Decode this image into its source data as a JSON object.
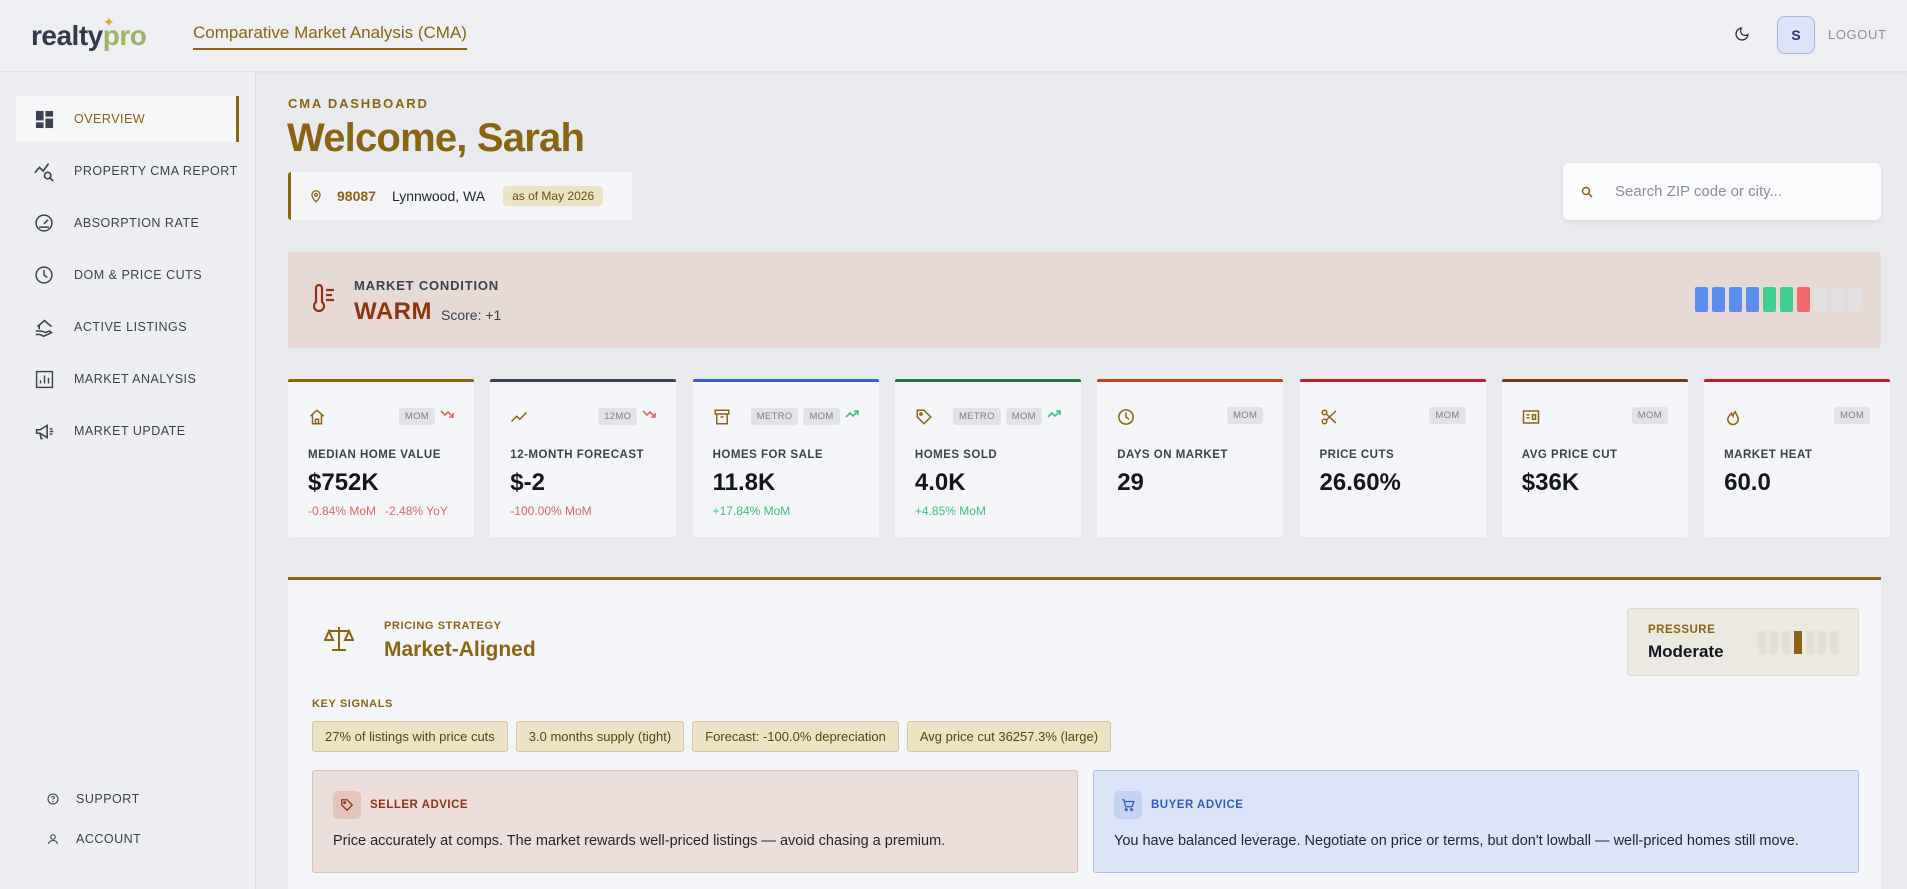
{
  "header": {
    "logo_primary": "realty",
    "logo_secondary": "pro",
    "title": "Comparative Market Analysis (CMA)",
    "theme_icon": "moon-icon",
    "avatar_initial": "S",
    "logout_label": "LOGOUT"
  },
  "sidebar": {
    "items": [
      {
        "label": "OVERVIEW",
        "icon": "dashboard-icon",
        "active": true
      },
      {
        "label": "PROPERTY CMA REPORT",
        "icon": "chart-search-icon"
      },
      {
        "label": "ABSORPTION RATE",
        "icon": "gauge-icon"
      },
      {
        "label": "DOM & PRICE CUTS",
        "icon": "clock-icon"
      },
      {
        "label": "ACTIVE LISTINGS",
        "icon": "house-hand-icon"
      },
      {
        "label": "MARKET ANALYSIS",
        "icon": "bar-chart-icon"
      },
      {
        "label": "MARKET UPDATE",
        "icon": "megaphone-icon"
      }
    ],
    "bottom": [
      {
        "label": "SUPPORT",
        "icon": "help-icon"
      },
      {
        "label": "ACCOUNT",
        "icon": "user-icon"
      }
    ]
  },
  "dashboard": {
    "kicker": "CMA DASHBOARD",
    "welcome": "Welcome, Sarah",
    "zip": "98087",
    "city": "Lynnwood, WA",
    "as_of": "as of May 2026"
  },
  "search": {
    "placeholder": "Search ZIP code or city..."
  },
  "market": {
    "label": "MARKET CONDITION",
    "value": "WARM",
    "score": "Score: +1",
    "meter_colors": [
      "#5b8dee",
      "#5b8dee",
      "#5b8dee",
      "#5b8dee",
      "#3fcf8e",
      "#3fcf8e",
      "#f26b6b",
      "#e4e1e2",
      "#e4e1e2",
      "#e4e1e2"
    ]
  },
  "cards": [
    {
      "label": "MEDIAN HOME VALUE",
      "value": "$752K",
      "tags": [
        "MOM"
      ],
      "trend": "down",
      "changes": [
        {
          "text": "-0.84% MoM",
          "dir": "neg"
        },
        {
          "text": "-2.48% YoY",
          "dir": "neg"
        }
      ],
      "accent": "#8a6410",
      "icon": "home-icon"
    },
    {
      "label": "12-MONTH FORECAST",
      "value": "$-2",
      "tags": [
        "12MO"
      ],
      "trend": "down",
      "changes": [
        {
          "text": "-100.00% MoM",
          "dir": "neg"
        }
      ],
      "accent": "#3b4258",
      "icon": "trend-icon"
    },
    {
      "label": "HOMES FOR SALE",
      "value": "11.8K",
      "tags": [
        "METRO",
        "MOM"
      ],
      "trend": "up",
      "changes": [
        {
          "text": "+17.84% MoM",
          "dir": "pos"
        }
      ],
      "accent": "#2f62d9",
      "icon": "archive-icon"
    },
    {
      "label": "HOMES SOLD",
      "value": "4.0K",
      "tags": [
        "METRO",
        "MOM"
      ],
      "trend": "up",
      "changes": [
        {
          "text": "+4.85% MoM",
          "dir": "pos"
        }
      ],
      "accent": "#1e7a3c",
      "icon": "tag-icon"
    },
    {
      "label": "DAYS ON MARKET",
      "value": "29",
      "tags": [
        "MOM"
      ],
      "trend": "",
      "changes": [],
      "accent": "#c0461a",
      "icon": "clock-icon"
    },
    {
      "label": "PRICE CUTS",
      "value": "26.60%",
      "tags": [
        "MOM"
      ],
      "trend": "",
      "changes": [],
      "accent": "#c41f1f",
      "icon": "scissors-icon"
    },
    {
      "label": "AVG PRICE CUT",
      "value": "$36K",
      "tags": [
        "MOM"
      ],
      "trend": "",
      "changes": [],
      "accent": "#7a3a14",
      "icon": "receipt-icon"
    },
    {
      "label": "MARKET HEAT",
      "value": "60.0",
      "tags": [
        "MOM"
      ],
      "trend": "",
      "changes": [],
      "accent": "#c41f1f",
      "icon": "flame-icon"
    }
  ],
  "strategy": {
    "label": "PRICING STRATEGY",
    "value": "Market-Aligned",
    "pressure_label": "PRESSURE",
    "pressure_value": "Moderate",
    "pressure_level": 4,
    "pressure_total": 7,
    "signals_label": "KEY SIGNALS",
    "signals": [
      "27% of listings with price cuts",
      "3.0 months supply (tight)",
      "Forecast: -100.0% depreciation",
      "Avg price cut 36257.3% (large)"
    ],
    "seller_title": "SELLER ADVICE",
    "seller_text": "Price accurately at comps. The market rewards well-priced listings — avoid chasing a premium.",
    "buyer_title": "BUYER ADVICE",
    "buyer_text": "You have balanced leverage. Negotiate on price or terms, but don't lowball — well-priced homes still move."
  }
}
